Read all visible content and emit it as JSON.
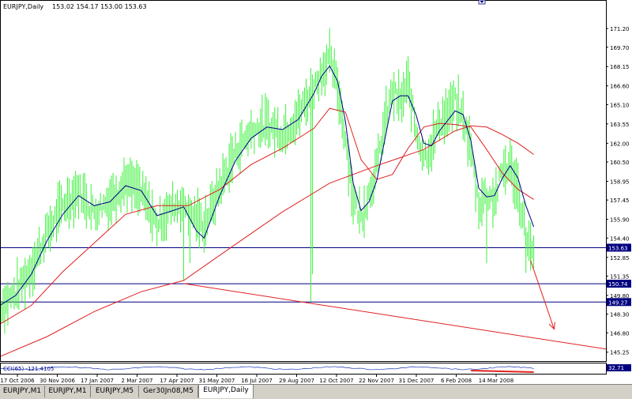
{
  "header": {
    "symbol_timeframe": "EURJPY,Daily",
    "ohlc": "153.02 154.17 153.00 153.63"
  },
  "indicator": {
    "label": "CCI(65) -121.4105",
    "value_badge": "32.71"
  },
  "tabs": [
    {
      "label": "EURJPY,M1",
      "active": false
    },
    {
      "label": "EURJPY,M1",
      "active": false
    },
    {
      "label": "EURJPY,M5",
      "active": false
    },
    {
      "label": "Ger30Jn08,M5",
      "active": false
    },
    {
      "label": "EURJPY,Daily",
      "active": true
    }
  ],
  "colors": {
    "price": "#3cf03c",
    "ma_short": "#00008b",
    "ma_mid": "#e02020",
    "trendline": "#e02020",
    "hline": "#000080",
    "arrow": "#e02020",
    "axis_text": "#000000",
    "badge_bg": "#000080"
  },
  "chart_data": {
    "type": "line",
    "title": "EURJPY,Daily",
    "ylim": [
      144.6,
      172.6
    ],
    "y_ticks": [
      "171.20",
      "169.70",
      "168.15",
      "166.60",
      "165.10",
      "163.55",
      "162.00",
      "160.50",
      "158.95",
      "157.45",
      "155.90",
      "154.40",
      "152.85",
      "151.35",
      "149.80",
      "148.30",
      "146.80",
      "145.25"
    ],
    "x_ticks": [
      "17 Oct 2006",
      "30 Nov 2006",
      "17 Jan 2007",
      "2 Mar 2007",
      "17 Apr 2007",
      "31 May 2007",
      "16 Jul 2007",
      "29 Aug 2007",
      "12 Oct 2007",
      "22 Nov 2007",
      "31 Dec 2007",
      "6 Feb 2008",
      "14 Mar 2008"
    ],
    "n_bars": 386,
    "horizontal_lines": [
      {
        "value": 153.63,
        "label": "153.63"
      },
      {
        "value": 150.74,
        "label": "150.74"
      },
      {
        "value": 149.27,
        "label": "149.27"
      }
    ],
    "trendline": {
      "from": {
        "bar": 117,
        "value": 150.75
      },
      "to": {
        "bar": 386,
        "value": 145.5
      }
    },
    "projection_arrow": {
      "from": {
        "bar": 338,
        "value": 152.6
      },
      "to": {
        "bar": 353,
        "value": 147.1
      }
    },
    "series": [
      {
        "name": "price",
        "x": [
          0,
          10,
          20,
          30,
          40,
          50,
          60,
          70,
          80,
          90,
          100,
          110,
          117,
          125,
          130,
          140,
          150,
          160,
          170,
          180,
          190,
          200,
          205,
          210,
          215,
          220,
          225,
          230,
          235,
          240,
          245,
          250,
          255,
          260,
          265,
          270,
          275,
          280,
          285,
          290,
          295,
          300,
          305,
          310,
          315,
          320,
          325,
          330,
          335,
          340
        ],
        "values": [
          148.9,
          150.0,
          152.0,
          154.8,
          157.0,
          158.2,
          156.5,
          157.5,
          159.0,
          158.0,
          155.5,
          157.0,
          157.2,
          156.0,
          155.4,
          158.5,
          161.3,
          163.0,
          163.5,
          162.8,
          164.2,
          166.5,
          167.8,
          168.8,
          166.5,
          162.5,
          157.5,
          156.0,
          158.0,
          160.0,
          163.5,
          166.2,
          165.2,
          166.8,
          163.0,
          161.0,
          161.8,
          163.8,
          164.3,
          165.3,
          164.0,
          161.5,
          157.0,
          158.0,
          157.5,
          159.8,
          160.2,
          158.2,
          154.8,
          152.8
        ]
      },
      {
        "name": "ma_short",
        "x": [
          0,
          10,
          20,
          30,
          40,
          50,
          60,
          70,
          80,
          90,
          100,
          110,
          117,
          125,
          130,
          140,
          150,
          160,
          170,
          180,
          190,
          200,
          205,
          210,
          215,
          220,
          225,
          230,
          235,
          240,
          245,
          250,
          255,
          260,
          265,
          270,
          275,
          280,
          285,
          290,
          295,
          300,
          305,
          310,
          315,
          320,
          325,
          330,
          335,
          340
        ],
        "values": [
          149.0,
          149.8,
          151.5,
          154.2,
          156.3,
          157.8,
          157.0,
          157.3,
          158.6,
          158.2,
          156.2,
          156.6,
          156.9,
          155.0,
          154.4,
          157.8,
          160.6,
          162.4,
          163.3,
          163.1,
          163.9,
          166.0,
          167.4,
          168.2,
          167.0,
          163.8,
          158.8,
          156.6,
          157.3,
          159.0,
          162.2,
          165.4,
          165.8,
          165.8,
          164.3,
          162.0,
          161.8,
          163.0,
          163.8,
          164.6,
          164.3,
          162.2,
          158.4,
          157.7,
          157.8,
          159.2,
          160.2,
          159.2,
          157.0,
          155.3
        ]
      },
      {
        "name": "ma_mid",
        "x": [
          0,
          20,
          40,
          60,
          80,
          100,
          120,
          140,
          160,
          180,
          200,
          210,
          220,
          230,
          240,
          250,
          260,
          270,
          280,
          290,
          300,
          310,
          320,
          330,
          340
        ],
        "values": [
          147.5,
          149.0,
          151.7,
          154.0,
          156.3,
          157.0,
          157.0,
          158.3,
          160.3,
          161.6,
          163.2,
          164.8,
          164.5,
          160.7,
          159.1,
          159.5,
          161.6,
          163.3,
          163.6,
          163.5,
          163.3,
          161.5,
          159.6,
          158.3,
          157.5
        ]
      },
      {
        "name": "ma_long",
        "x": [
          0,
          30,
          60,
          90,
          117,
          150,
          180,
          210,
          240,
          270,
          290,
          300,
          310,
          320,
          330,
          340
        ],
        "values": [
          144.9,
          146.5,
          148.5,
          150.1,
          151.0,
          153.9,
          156.5,
          158.8,
          160.2,
          161.5,
          163.0,
          163.4,
          163.3,
          162.7,
          162.0,
          161.1
        ]
      }
    ]
  }
}
